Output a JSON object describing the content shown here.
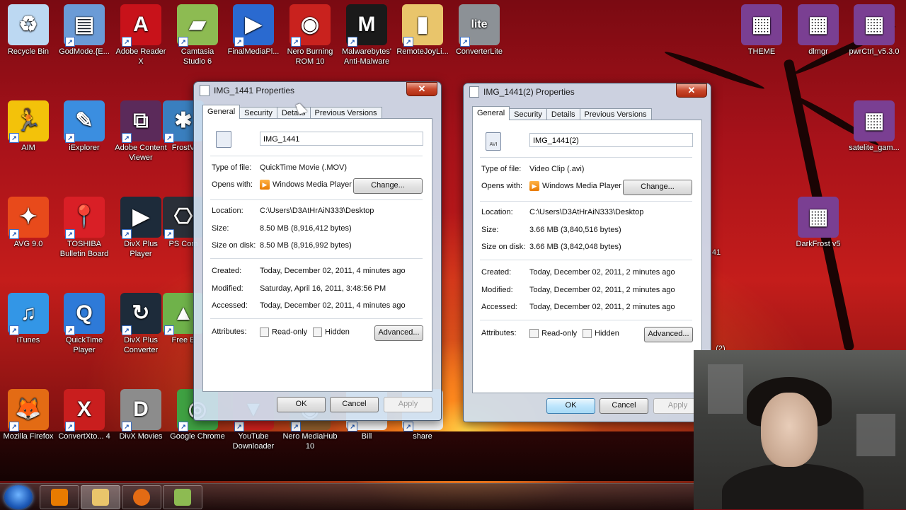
{
  "desktop": {
    "icons": [
      {
        "label": "Recycle Bin",
        "icon": "recycle-bin-icon",
        "color": "#bcd8f2",
        "glyph": "♻"
      },
      {
        "label": "GodMode.{E...",
        "icon": "control-panel-icon",
        "color": "#6b9bd6",
        "glyph": "▤"
      },
      {
        "label": "Adobe Reader X",
        "icon": "adobe-reader-icon",
        "color": "#c8121a",
        "glyph": "A"
      },
      {
        "label": "Camtasia Studio 6",
        "icon": "camtasia-icon",
        "color": "#8dbb52",
        "glyph": "▰"
      },
      {
        "label": "FinalMediaPl...",
        "icon": "media-player-icon",
        "color": "#2a6ad0",
        "glyph": "▶"
      },
      {
        "label": "Nero Burning ROM 10",
        "icon": "nero-icon",
        "color": "#c9221e",
        "glyph": "◉"
      },
      {
        "label": "Malwarebytes' Anti-Malware",
        "icon": "malwarebytes-icon",
        "color": "#1a1a1a",
        "glyph": "M"
      },
      {
        "label": "RemoteJoyLi...",
        "icon": "folder-icon",
        "color": "#e9c56b",
        "glyph": "▮"
      },
      {
        "label": "ConverterLite",
        "icon": "converterlite-icon",
        "color": "#8c9196",
        "glyph": "lite"
      },
      {
        "label": "THEME",
        "icon": "winrar-icon",
        "color": "#7a3f92",
        "glyph": "▦"
      },
      {
        "label": "dlmgr",
        "icon": "winrar-icon",
        "color": "#7a3f92",
        "glyph": "▦"
      },
      {
        "label": "pwrCtrl_v5.3.0",
        "icon": "winrar-icon",
        "color": "#7a3f92",
        "glyph": "▦"
      },
      {
        "label": "AIM",
        "icon": "aim-icon",
        "color": "#f3c20a",
        "glyph": "🏃"
      },
      {
        "label": "iExplorer",
        "icon": "iexplorer-icon",
        "color": "#3b8ee0",
        "glyph": "✎"
      },
      {
        "label": "Adobe Content Viewer",
        "icon": "adobe-content-viewer-icon",
        "color": "#5b2a5a",
        "glyph": "⧉"
      },
      {
        "label": "FrostV",
        "icon": "frostwire-icon",
        "color": "#3a7fbf",
        "glyph": "✱"
      },
      {
        "label": "satelite_gam...",
        "icon": "winrar-icon",
        "color": "#7a3f92",
        "glyph": "▦"
      },
      {
        "label": "AVG 9.0",
        "icon": "avg-icon",
        "color": "#e84a1b",
        "glyph": "✦"
      },
      {
        "label": "TOSHIBA Bulletin Board",
        "icon": "pushpin-icon",
        "color": "#d91f26",
        "glyph": "📍"
      },
      {
        "label": "DivX Plus Player",
        "icon": "divx-player-icon",
        "color": "#1d2b3a",
        "glyph": "▶"
      },
      {
        "label": "PS Com",
        "icon": "ps-icon",
        "color": "#2a2f38",
        "glyph": "⎔"
      },
      {
        "label": "DarkFrost v5",
        "icon": "winrar-icon",
        "color": "#7a3f92",
        "glyph": "▦"
      },
      {
        "label": "iTunes",
        "icon": "itunes-icon",
        "color": "#3396e6",
        "glyph": "♫"
      },
      {
        "label": "QuickTime Player",
        "icon": "quicktime-icon",
        "color": "#2e7ad8",
        "glyph": "Q"
      },
      {
        "label": "DivX Plus Converter",
        "icon": "divx-converter-icon",
        "color": "#1d2b3a",
        "glyph": "↻"
      },
      {
        "label": "Free E",
        "icon": "free-app-icon",
        "color": "#6fb24a",
        "glyph": "▲"
      },
      {
        "label": "Mozilla Firefox",
        "icon": "firefox-icon",
        "color": "#e36b14",
        "glyph": "🦊"
      },
      {
        "label": "ConvertXto... 4",
        "icon": "convertx-icon",
        "color": "#c91e1e",
        "glyph": "X"
      },
      {
        "label": "DivX Movies",
        "icon": "divx-movies-icon",
        "color": "#8c8c8c",
        "glyph": "D"
      },
      {
        "label": "Google Chrome",
        "icon": "chrome-icon",
        "color": "#3fa142",
        "glyph": "◎"
      },
      {
        "label": "YouTube Downloader",
        "icon": "youtube-downloader-icon",
        "color": "#c8201c",
        "glyph": "▼"
      },
      {
        "label": "Nero MediaHub 10",
        "icon": "nero-mediahub-icon",
        "color": "#8a5a2a",
        "glyph": "◉"
      },
      {
        "label": "Bill",
        "icon": "document-icon",
        "color": "#f2f2f2",
        "glyph": ""
      },
      {
        "label": "share",
        "icon": "document-icon",
        "color": "#f2f2f2",
        "glyph": ""
      }
    ],
    "partial_labels": {
      "a": "41",
      "b": "(2)"
    }
  },
  "window1": {
    "title": "IMG_1441 Properties",
    "tabs": [
      "General",
      "Security",
      "Details",
      "Previous Versions"
    ],
    "file_name": "IMG_1441",
    "type_label": "Type of file:",
    "type_value": "QuickTime Movie (.MOV)",
    "opens_label": "Opens with:",
    "opens_value": "Windows Media Player",
    "change_button": "Change...",
    "location_label": "Location:",
    "location_value": "C:\\Users\\D3AtHrAiN333\\Desktop",
    "size_label": "Size:",
    "size_value": "8.50 MB (8,916,412 bytes)",
    "size_disk_label": "Size on disk:",
    "size_disk_value": "8.50 MB (8,916,992 bytes)",
    "created_label": "Created:",
    "created_value": "Today, December 02, 2011, 4 minutes ago",
    "modified_label": "Modified:",
    "modified_value": "Saturday, April 16, 2011, 3:48:56 PM",
    "accessed_label": "Accessed:",
    "accessed_value": "Today, December 02, 2011, 4 minutes ago",
    "attributes_label": "Attributes:",
    "readonly_label": "Read-only",
    "hidden_label": "Hidden",
    "advanced_button": "Advanced...",
    "ok": "OK",
    "cancel": "Cancel",
    "apply": "Apply"
  },
  "window2": {
    "title": "IMG_1441(2) Properties",
    "tabs": [
      "General",
      "Security",
      "Details",
      "Previous Versions"
    ],
    "file_name": "IMG_1441(2)",
    "file_icon_text": "AVI",
    "type_label": "Type of file:",
    "type_value": "Video Clip (.avi)",
    "opens_label": "Opens with:",
    "opens_value": "Windows Media Player",
    "change_button": "Change...",
    "location_label": "Location:",
    "location_value": "C:\\Users\\D3AtHrAiN333\\Desktop",
    "size_label": "Size:",
    "size_value": "3.66 MB (3,840,516 bytes)",
    "size_disk_label": "Size on disk:",
    "size_disk_value": "3.66 MB (3,842,048 bytes)",
    "created_label": "Created:",
    "created_value": "Today, December 02, 2011, 2 minutes ago",
    "modified_label": "Modified:",
    "modified_value": "Today, December 02, 2011, 2 minutes ago",
    "accessed_label": "Accessed:",
    "accessed_value": "Today, December 02, 2011, 2 minutes ago",
    "attributes_label": "Attributes:",
    "readonly_label": "Read-only",
    "hidden_label": "Hidden",
    "advanced_button": "Advanced...",
    "ok": "OK",
    "cancel": "Cancel",
    "apply": "Apply"
  },
  "taskbar": {
    "items": [
      {
        "icon": "media-player-icon",
        "color": "#e87b00"
      },
      {
        "icon": "explorer-icon",
        "color": "#e9c56b"
      },
      {
        "icon": "firefox-icon",
        "color": "#e36b14"
      },
      {
        "icon": "camtasia-icon",
        "color": "#8dbb52"
      }
    ]
  },
  "colors": {
    "accent": "#3c7fb1",
    "close": "#c9472b"
  }
}
